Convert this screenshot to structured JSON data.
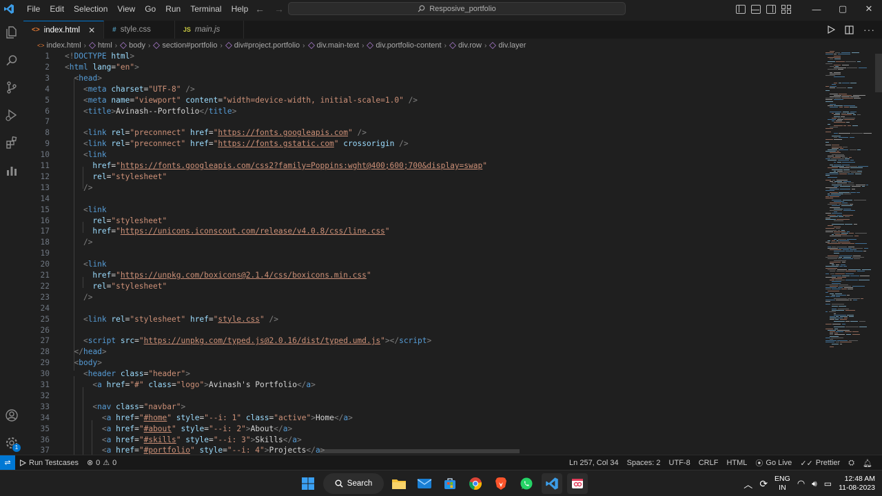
{
  "window": {
    "menu": [
      "File",
      "Edit",
      "Selection",
      "View",
      "Go",
      "Run",
      "Terminal",
      "Help"
    ],
    "search_text": "Resposive_portfolio",
    "controls": {
      "minimize": "—",
      "maximize": "▢",
      "close": "✕"
    }
  },
  "tabs": [
    {
      "label": "index.html",
      "icon": "html-file-icon",
      "active": true,
      "close": "✕"
    },
    {
      "label": "style.css",
      "icon": "css-file-icon",
      "active": false
    },
    {
      "label": "main.js",
      "icon": "js-file-icon",
      "active": false
    }
  ],
  "breadcrumb": [
    "index.html",
    "html",
    "body",
    "section#portfolio",
    "div#project.portfolio",
    "div.main-text",
    "div.portfolio-content",
    "div.row",
    "div.layer"
  ],
  "editor": {
    "lines": [
      {
        "n": "1",
        "h": "<span class='t-br'>&lt;!</span><span class='t-tag'>DOCTYPE</span> <span class='t-attr'>html</span><span class='t-br'>&gt;</span>"
      },
      {
        "n": "2",
        "h": "<span class='t-br'>&lt;</span><span class='t-tag'>html</span> <span class='t-attr'>lang</span><span class='t-txt'>=</span><span class='t-str'>\"en\"</span><span class='t-br'>&gt;</span>"
      },
      {
        "n": "3",
        "h": "  <span class='t-br'>&lt;</span><span class='t-tag'>head</span><span class='t-br'>&gt;</span>"
      },
      {
        "n": "4",
        "h": "    <span class='t-br'>&lt;</span><span class='t-tag'>meta</span> <span class='t-attr'>charset</span><span class='t-txt'>=</span><span class='t-str'>\"UTF-8\"</span> <span class='t-br'>/&gt;</span>"
      },
      {
        "n": "5",
        "h": "    <span class='t-br'>&lt;</span><span class='t-tag'>meta</span> <span class='t-attr'>name</span><span class='t-txt'>=</span><span class='t-str'>\"viewport\"</span> <span class='t-attr'>content</span><span class='t-txt'>=</span><span class='t-str'>\"width=device-width, initial-scale=1.0\"</span> <span class='t-br'>/&gt;</span>"
      },
      {
        "n": "6",
        "h": "    <span class='t-br'>&lt;</span><span class='t-tag'>title</span><span class='t-br'>&gt;</span><span class='t-txt'>Avinash--Portfolio</span><span class='t-br'>&lt;/</span><span class='t-tag'>title</span><span class='t-br'>&gt;</span>"
      },
      {
        "n": "7",
        "h": ""
      },
      {
        "n": "8",
        "h": "    <span class='t-br'>&lt;</span><span class='t-tag'>link</span> <span class='t-attr'>rel</span><span class='t-txt'>=</span><span class='t-str'>\"preconnect\"</span> <span class='t-attr'>href</span><span class='t-txt'>=</span><span class='t-str'>\"</span><span class='t-url'>https://fonts.googleapis.com</span><span class='t-str'>\"</span> <span class='t-br'>/&gt;</span>"
      },
      {
        "n": "9",
        "h": "    <span class='t-br'>&lt;</span><span class='t-tag'>link</span> <span class='t-attr'>rel</span><span class='t-txt'>=</span><span class='t-str'>\"preconnect\"</span> <span class='t-attr'>href</span><span class='t-txt'>=</span><span class='t-str'>\"</span><span class='t-url'>https://fonts.gstatic.com</span><span class='t-str'>\"</span> <span class='t-attr'>crossorigin</span> <span class='t-br'>/&gt;</span>"
      },
      {
        "n": "10",
        "h": "    <span class='t-br'>&lt;</span><span class='t-tag'>link</span>"
      },
      {
        "n": "11",
        "h": "      <span class='t-attr'>href</span><span class='t-txt'>=</span><span class='t-str'>\"</span><span class='t-url'>https://fonts.googleapis.com/css2?family=Poppins:wght@400;600;700&amp;display=swap</span><span class='t-str'>\"</span>"
      },
      {
        "n": "12",
        "h": "      <span class='t-attr'>rel</span><span class='t-txt'>=</span><span class='t-str'>\"stylesheet\"</span>"
      },
      {
        "n": "13",
        "h": "    <span class='t-br'>/&gt;</span>"
      },
      {
        "n": "14",
        "h": ""
      },
      {
        "n": "15",
        "h": "    <span class='t-br'>&lt;</span><span class='t-tag'>link</span>"
      },
      {
        "n": "16",
        "h": "      <span class='t-attr'>rel</span><span class='t-txt'>=</span><span class='t-str'>\"stylesheet\"</span>"
      },
      {
        "n": "17",
        "h": "      <span class='t-attr'>href</span><span class='t-txt'>=</span><span class='t-str'>\"</span><span class='t-url'>https://unicons.iconscout.com/release/v4.0.8/css/line.css</span><span class='t-str'>\"</span>"
      },
      {
        "n": "18",
        "h": "    <span class='t-br'>/&gt;</span>"
      },
      {
        "n": "19",
        "h": ""
      },
      {
        "n": "20",
        "h": "    <span class='t-br'>&lt;</span><span class='t-tag'>link</span>"
      },
      {
        "n": "21",
        "h": "      <span class='t-attr'>href</span><span class='t-txt'>=</span><span class='t-str'>\"</span><span class='t-url'>https://unpkg.com/boxicons@2.1.4/css/boxicons.min.css</span><span class='t-str'>\"</span>"
      },
      {
        "n": "22",
        "h": "      <span class='t-attr'>rel</span><span class='t-txt'>=</span><span class='t-str'>\"stylesheet\"</span>"
      },
      {
        "n": "23",
        "h": "    <span class='t-br'>/&gt;</span>"
      },
      {
        "n": "24",
        "h": ""
      },
      {
        "n": "25",
        "h": "    <span class='t-br'>&lt;</span><span class='t-tag'>link</span> <span class='t-attr'>rel</span><span class='t-txt'>=</span><span class='t-str'>\"stylesheet\"</span> <span class='t-attr'>href</span><span class='t-txt'>=</span><span class='t-str'>\"</span><span class='t-url'>style.css</span><span class='t-str'>\"</span> <span class='t-br'>/&gt;</span>"
      },
      {
        "n": "26",
        "h": ""
      },
      {
        "n": "27",
        "h": "    <span class='t-br'>&lt;</span><span class='t-tag'>script</span> <span class='t-attr'>src</span><span class='t-txt'>=</span><span class='t-str'>\"</span><span class='t-url'>https://unpkg.com/typed.js@2.0.16/dist/typed.umd.js</span><span class='t-str'>\"</span><span class='t-br'>&gt;&lt;/</span><span class='t-tag'>script</span><span class='t-br'>&gt;</span>"
      },
      {
        "n": "28",
        "h": "  <span class='t-br'>&lt;/</span><span class='t-tag'>head</span><span class='t-br'>&gt;</span>"
      },
      {
        "n": "29",
        "h": "  <span class='t-br'>&lt;</span><span class='t-tag'>body</span><span class='t-br'>&gt;</span>"
      },
      {
        "n": "30",
        "h": "    <span class='t-br'>&lt;</span><span class='t-tag'>header</span> <span class='t-attr'>class</span><span class='t-txt'>=</span><span class='t-str'>\"header\"</span><span class='t-br'>&gt;</span>"
      },
      {
        "n": "31",
        "h": "      <span class='t-br'>&lt;</span><span class='t-tag'>a</span> <span class='t-attr'>href</span><span class='t-txt'>=</span><span class='t-str'>\"#\"</span> <span class='t-attr'>class</span><span class='t-txt'>=</span><span class='t-str'>\"logo\"</span><span class='t-br'>&gt;</span><span class='t-txt'>Avinash's Portfolio</span><span class='t-br'>&lt;/</span><span class='t-tag'>a</span><span class='t-br'>&gt;</span>"
      },
      {
        "n": "32",
        "h": ""
      },
      {
        "n": "33",
        "h": "      <span class='t-br'>&lt;</span><span class='t-tag'>nav</span> <span class='t-attr'>class</span><span class='t-txt'>=</span><span class='t-str'>\"navbar\"</span><span class='t-br'>&gt;</span>"
      },
      {
        "n": "34",
        "h": "        <span class='t-br'>&lt;</span><span class='t-tag'>a</span> <span class='t-attr'>href</span><span class='t-txt'>=</span><span class='t-str'>\"</span><span class='t-url'>#home</span><span class='t-str'>\"</span> <span class='t-attr'>style</span><span class='t-txt'>=</span><span class='t-str'>\"--i: 1\"</span> <span class='t-attr'>class</span><span class='t-txt'>=</span><span class='t-str'>\"active\"</span><span class='t-br'>&gt;</span><span class='t-txt'>Home</span><span class='t-br'>&lt;/</span><span class='t-tag'>a</span><span class='t-br'>&gt;</span>"
      },
      {
        "n": "35",
        "h": "        <span class='t-br'>&lt;</span><span class='t-tag'>a</span> <span class='t-attr'>href</span><span class='t-txt'>=</span><span class='t-str'>\"</span><span class='t-url'>#about</span><span class='t-str'>\"</span> <span class='t-attr'>style</span><span class='t-txt'>=</span><span class='t-str'>\"--i: 2\"</span><span class='t-br'>&gt;</span><span class='t-txt'>About</span><span class='t-br'>&lt;/</span><span class='t-tag'>a</span><span class='t-br'>&gt;</span>"
      },
      {
        "n": "36",
        "h": "        <span class='t-br'>&lt;</span><span class='t-tag'>a</span> <span class='t-attr'>href</span><span class='t-txt'>=</span><span class='t-str'>\"</span><span class='t-url'>#skills</span><span class='t-str'>\"</span> <span class='t-attr'>style</span><span class='t-txt'>=</span><span class='t-str'>\"--i: 3\"</span><span class='t-br'>&gt;</span><span class='t-txt'>Skills</span><span class='t-br'>&lt;/</span><span class='t-tag'>a</span><span class='t-br'>&gt;</span>"
      },
      {
        "n": "37",
        "h": "        <span class='t-br'>&lt;</span><span class='t-tag'>a</span> <span class='t-attr'>href</span><span class='t-txt'>=</span><span class='t-str'>\"</span><span class='t-url'>#portfolio</span><span class='t-str'>\"</span> <span class='t-attr'>style</span><span class='t-txt'>=</span><span class='t-str'>\"--i: 4\"</span><span class='t-br'>&gt;</span><span class='t-txt'>Projects</span><span class='t-br'>&lt;/</span><span class='t-tag'>a</span><span class='t-br'>&gt;</span>"
      }
    ]
  },
  "status": {
    "run_testcases": "Run Testcases",
    "errors": "0",
    "warnings": "0",
    "position": "Ln 257, Col 34",
    "spaces": "Spaces: 2",
    "encoding": "UTF-8",
    "eol": "CRLF",
    "language": "HTML",
    "go_live": "Go Live",
    "prettier": "Prettier"
  },
  "taskbar": {
    "search_label": "Search",
    "lang_line1": "ENG",
    "lang_line2": "IN",
    "time": "12:48 AM",
    "date": "11-08-2023"
  },
  "colors": {
    "accent": "#0078d4",
    "tag": "#569cd6",
    "attribute": "#9cdcfe",
    "string": "#ce9178"
  }
}
